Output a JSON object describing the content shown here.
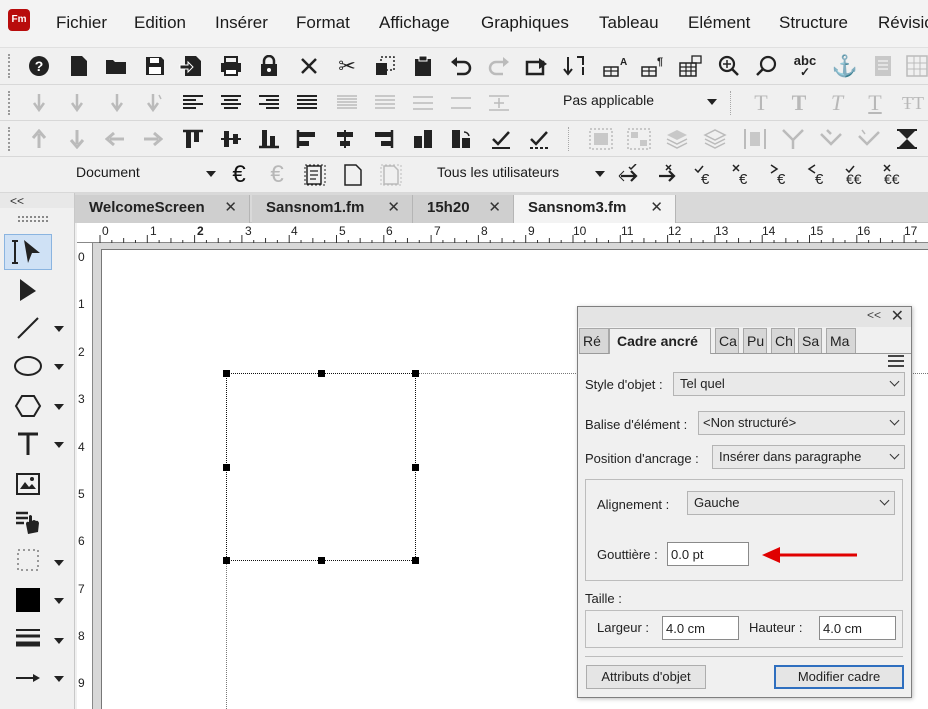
{
  "menu": {
    "logo": "Fm",
    "items": [
      "Fichier",
      "Edition",
      "Insérer",
      "Format",
      "Affichage",
      "Graphiques",
      "Tableau",
      "Elément",
      "Structure",
      "Révisio"
    ]
  },
  "toolbar1": {
    "icons": [
      "help-icon",
      "new-document-icon",
      "open-folder-icon",
      "save-icon",
      "save-as-icon",
      "print-icon",
      "lock-icon",
      "close-x-icon",
      "cut-icon",
      "copy-icon",
      "paste-icon",
      "undo-icon",
      "redo-icon",
      "redo-arrow-icon",
      "sort-icon",
      "table-icon-1",
      "table-icon-2",
      "table-icon-3",
      "find-replace-icon",
      "search-icon",
      "spellcheck-icon",
      "anchor-icon",
      "document-icon-disabled",
      "grid-icon-disabled"
    ],
    "spellcheck_label": "abc"
  },
  "toolbar2": {
    "paragraph_combo": "Pas applicable",
    "icons": [
      "indent-down-icon",
      "indent-down-2-icon",
      "indent-down-3-icon",
      "indent-custom-icon",
      "align-left-icon",
      "align-center-icon",
      "align-right-icon",
      "justify-icon",
      "line-spacing-icon",
      "line-spacing-2-icon",
      "line-spacing-3-icon",
      "line-spacing-4-icon",
      "add-space-icon",
      "font-normal-icon",
      "font-bold-icon",
      "font-italic-icon",
      "font-underline-icon",
      "font-size-icon"
    ]
  },
  "toolbar3": {
    "icons": [
      "move-up-icon",
      "move-down-icon",
      "move-left-icon",
      "move-right-icon",
      "align-top-icon",
      "align-middle-icon",
      "align-bottom-icon",
      "align-left-obj-icon",
      "align-center-obj-icon",
      "align-right-obj-icon",
      "rotate-icon",
      "flip-icon",
      "check-icon",
      "check-double-icon",
      "group-icon",
      "ungroup-icon",
      "bring-front-icon",
      "send-back-icon",
      "distribute-icon",
      "merge-icon",
      "split-icon",
      "arrow-merge-icon",
      "triangle-icon"
    ]
  },
  "toolbar4": {
    "view_combo": "Document",
    "users_combo": "Tous les utilisateurs"
  },
  "tabs": [
    {
      "label": "WelcomeScreen",
      "close": "✕",
      "active": false
    },
    {
      "label": "Sansnom1.fm",
      "close": "✕",
      "active": false
    },
    {
      "label": "15h20",
      "close": "✕",
      "active": false
    },
    {
      "label": "Sansnom3.fm",
      "close": "✕",
      "active": true
    }
  ],
  "side_collapse": "<<",
  "ruler_h": [
    "0",
    "1",
    "2",
    "3",
    "4",
    "5",
    "6",
    "7",
    "8",
    "9",
    "10",
    "11",
    "12",
    "13",
    "14",
    "15",
    "16",
    "17"
  ],
  "ruler_v": [
    "0",
    "1",
    "2",
    "3",
    "4",
    "5",
    "6",
    "7",
    "8",
    "9"
  ],
  "dialog": {
    "collapse": "<<",
    "close": "✕",
    "tabs": [
      "Ré",
      "Cadre ancré",
      "Ca",
      "Pu",
      "Ch",
      "Sa",
      "Ma"
    ],
    "object_style_label": "Style d'objet :",
    "object_style_value": "Tel quel",
    "element_tag_label": "Balise d'élément :",
    "element_tag_value": "<Non structuré>",
    "anchor_position_label": "Position d'ancrage :",
    "anchor_position_value": "Insérer dans paragraphe",
    "alignment_label": "Alignement :",
    "alignment_value": "Gauche",
    "gutter_label": "Gouttière :",
    "gutter_value": "0.0 pt",
    "size_label": "Taille :",
    "width_label": "Largeur :",
    "width_value": "4.0 cm",
    "height_label": "Hauteur :",
    "height_value": "4.0 cm",
    "object_attributes_button": "Attributs d'objet",
    "modify_frame_button": "Modifier cadre"
  },
  "colors": {
    "accent_blue": "#2f6fbf",
    "annotation_red": "#e00000",
    "logo_red": "#b80c0c"
  }
}
